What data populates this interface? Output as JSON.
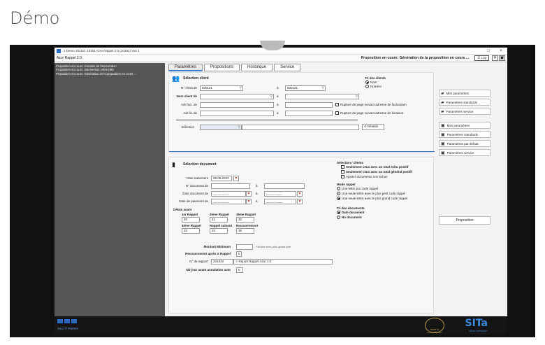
{
  "page": {
    "title": "Démo"
  },
  "window": {
    "titlebar": "1 Demo 202121 10301 Azur Rappel 2.0 (10301) Vue 1",
    "app_name": "Azur Rappel 2.0",
    "status": "Proposition en cours: Génération de la proposition en cours ...",
    "log_label": "Log",
    "minimize": "□",
    "close": "×"
  },
  "sidebar": {
    "lines": [
      "Proposition en cours: Création de l'intervention",
      "Proposition en cours: Intervention créée (86)",
      "Proposition en cours: Génération de la proposition en cours ..."
    ]
  },
  "tabs": [
    "Paramètres",
    "Propositions",
    "Historique",
    "Service"
  ],
  "client": {
    "section_title": "Sélection client",
    "no_client_label": "N° client de",
    "no_client_from": "500121",
    "to_label": "à",
    "no_client_to": "500121",
    "nom_client_label": "Nom client de",
    "adr_fact_label": "Adr fact. de",
    "adr_liv_label": "Adr liv. de",
    "rupture_fact": "Rupture de page suivant adresse de facturation",
    "rupture_liv": "Rupture de page suivant adresse de livraison",
    "selection_label": "Sélection",
    "retablir": "Rétablir",
    "tri_title": "Tri des clients",
    "tri_nom": "Nom",
    "tri_numero": "Numéro"
  },
  "document": {
    "section_title": "Sélection document",
    "date_traitement_label": "Date traitement",
    "date_traitement": "08.06.2022",
    "no_doc_label": "N° document de",
    "date_doc_label": "Date document de",
    "date_paiement_label": "Date de paiement de",
    "date_placeholder": "__.__.____",
    "delais_title": "Délais avant",
    "rappel1_label": "1er Rappel",
    "rappel1": "30",
    "rappel2_label": "2ème Rappel",
    "rappel2": "31",
    "rappel3_label": "3ème Rappel",
    "rappel3": "32",
    "rappel4_label": "4ème Rappel",
    "rappel4": "33",
    "rappel_suivant_label": "Rappel suivant",
    "rappel_suivant": "34",
    "recouvrement_label": "Recouvrement",
    "recouvrement": "35",
    "montant_min_label": "Montant Minimum",
    "montant_min_note": "Facture sera plus grand que",
    "recouv_apres_label": "Recouvrement après X Rappel",
    "recouv_apres": "5",
    "no_rapport_label": "N° de rapport",
    "no_rapport": "201343",
    "rapport_name": "Report Rappel Azur 2.0",
    "nb_jours_label": "Nb jour avant annulation auto",
    "nb_jours": "0"
  },
  "selection_clients": {
    "title": "Sélection / clients",
    "opt1": "Seulement ceux avec un total échu positif",
    "opt2": "Seulement ceux avec un total général positif",
    "opt3": "Ajouter documents non échus",
    "mode_title": "Mode rappel",
    "mode1": "Une lettre par code rappel",
    "mode2": "Une seule lettre avec le plus petit code rappel",
    "mode3": "Une seule lettre avec le plus grand code rappel",
    "tri_doc_title": "Tri des documents",
    "tri_date": "Date document",
    "tri_no": "No document"
  },
  "right_buttons": {
    "group1": [
      "Mes paramètres",
      "Paramètres standards",
      "Paramètres service"
    ],
    "group2": [
      "Mes paramètres",
      "Paramètres standards",
      "Paramètres par défaut",
      "Paramètres service"
    ],
    "proposition": "Proposition"
  },
  "footer": {
    "tagline": "Your IT Partner",
    "brand": "SITa",
    "brand_sub": "DÉVELOPPEMENT",
    "badge": "MADE IN LUXEMBOURG"
  }
}
